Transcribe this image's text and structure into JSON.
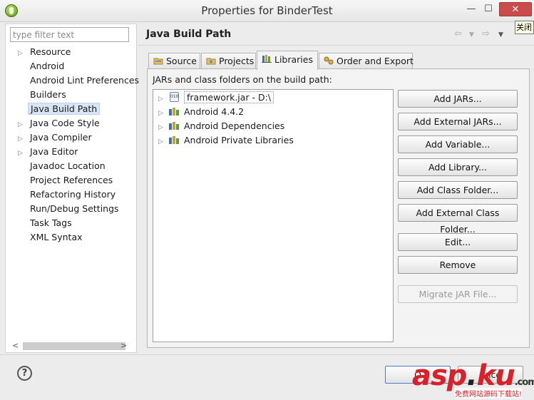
{
  "window": {
    "title": "Properties for BinderTest",
    "close_tooltip": "关闭",
    "minimize_glyph": "—",
    "maximize_glyph": "☐",
    "close_glyph": "✕"
  },
  "filter": {
    "placeholder": "type filter text",
    "value": ""
  },
  "nav_tree": [
    {
      "label": "Resource",
      "expandable": true
    },
    {
      "label": "Android",
      "expandable": false
    },
    {
      "label": "Android Lint Preferences",
      "expandable": false
    },
    {
      "label": "Builders",
      "expandable": false
    },
    {
      "label": "Java Build Path",
      "expandable": false,
      "selected": true
    },
    {
      "label": "Java Code Style",
      "expandable": true
    },
    {
      "label": "Java Compiler",
      "expandable": true
    },
    {
      "label": "Java Editor",
      "expandable": true
    },
    {
      "label": "Javadoc Location",
      "expandable": false
    },
    {
      "label": "Project References",
      "expandable": false
    },
    {
      "label": "Refactoring History",
      "expandable": false
    },
    {
      "label": "Run/Debug Settings",
      "expandable": false
    },
    {
      "label": "Task Tags",
      "expandable": false
    },
    {
      "label": "XML Syntax",
      "expandable": false
    }
  ],
  "page": {
    "title": "Java Build Path"
  },
  "tabs": [
    {
      "label": "Source",
      "icon": "source-folder-icon"
    },
    {
      "label": "Projects",
      "icon": "projects-folder-icon"
    },
    {
      "label": "Libraries",
      "icon": "libraries-icon",
      "active": true
    },
    {
      "label": "Order and Export",
      "icon": "order-export-icon"
    }
  ],
  "libraries": {
    "caption": "JARs and class folders on the build path:",
    "items": [
      {
        "label": "framework.jar - D:\\",
        "icon": "jar-icon"
      },
      {
        "label": "Android 4.4.2",
        "icon": "library-container-icon"
      },
      {
        "label": "Android Dependencies",
        "icon": "library-container-icon"
      },
      {
        "label": "Android Private Libraries",
        "icon": "library-container-icon"
      }
    ]
  },
  "buttons": {
    "add_jars": "Add JARs...",
    "add_external_jars": "Add External JARs...",
    "add_variable": "Add Variable...",
    "add_library": "Add Library...",
    "add_class_folder": "Add Class Folder...",
    "add_external_class_folder": "Add External Class Folder...",
    "edit": "Edit...",
    "remove": "Remove",
    "migrate_jar": "Migrate JAR File..."
  },
  "footer": {
    "help_glyph": "?",
    "ok_visible_fragment": "O",
    "cancel_visible_fragment": "ance"
  },
  "watermark": {
    "logo": "asp",
    "logo_dot": ".",
    "logo_end": "ku",
    "logo_suffix": ".com",
    "subtitle": "免费网站源码下载站!"
  },
  "colors": {
    "selection": "#d7e5f5",
    "close_button": "#c94c4c",
    "watermark_red": "#d8212b"
  }
}
